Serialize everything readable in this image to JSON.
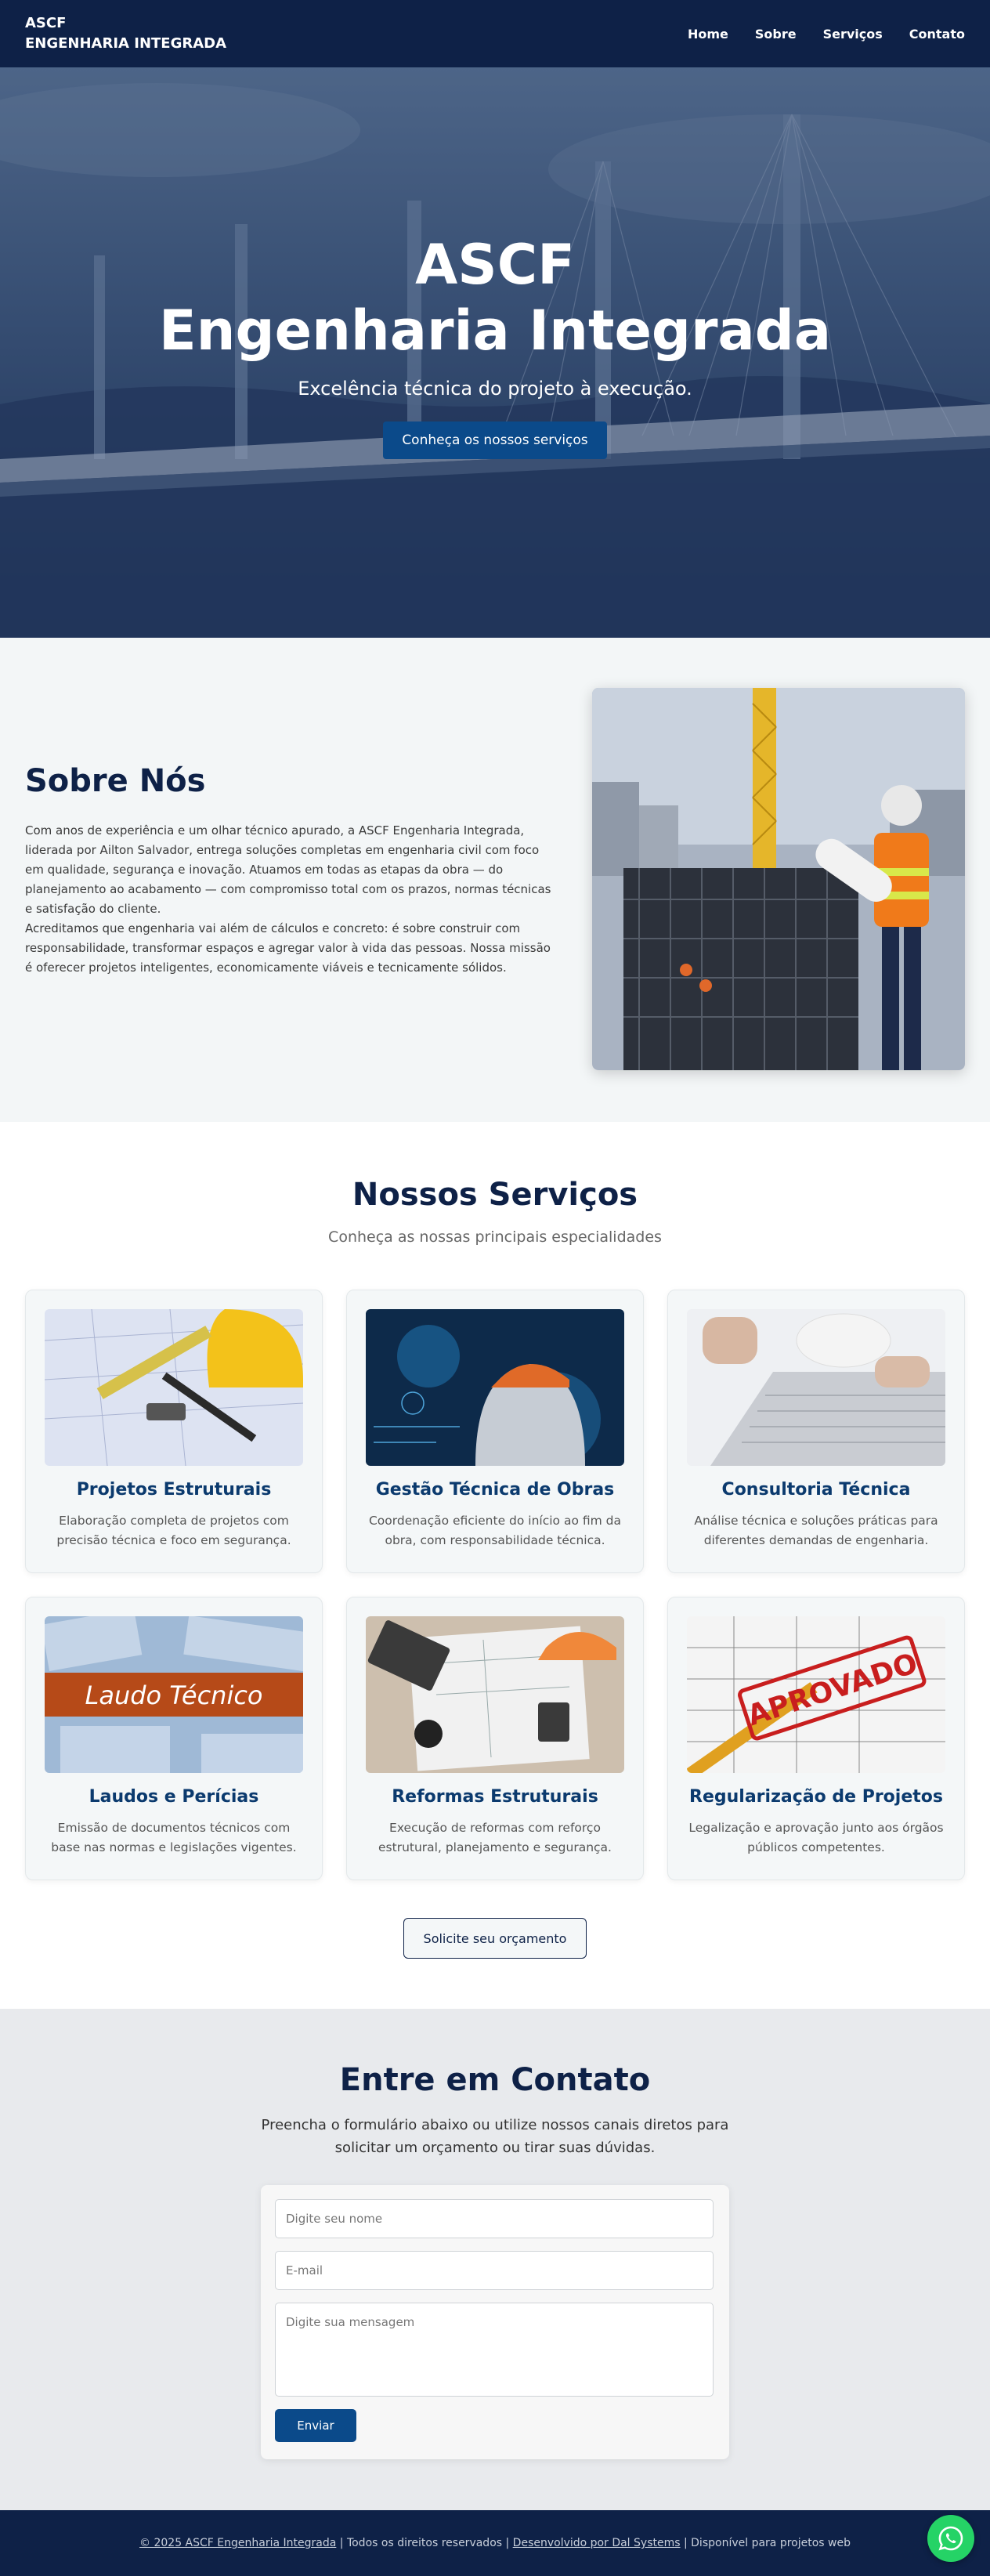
{
  "header": {
    "logo_line1": "ASCF",
    "logo_line2": "ENGENHARIA INTEGRADA",
    "nav": [
      "Home",
      "Sobre",
      "Serviços",
      "Contato"
    ]
  },
  "hero": {
    "title_line1": "ASCF",
    "title_line2": "Engenharia Integrada",
    "subtitle": "Excelência técnica do projeto à execução.",
    "button": "Conheça os nossos serviços"
  },
  "about": {
    "title": "Sobre Nós",
    "paragraph1": "Com anos de experiência e um olhar técnico apurado, a ASCF Engenharia Integrada, liderada por Ailton Salvador, entrega soluções completas em engenharia civil com foco em qualidade, segurança e inovação. Atuamos em todas as etapas da obra — do planejamento ao acabamento — com compromisso total com os prazos, normas técnicas e satisfação do cliente.",
    "paragraph2": "Acreditamos que engenharia vai além de cálculos e concreto: é sobre construir com responsabilidade, transformar espaços e agregar valor à vida das pessoas. Nossa missão é oferecer projetos inteligentes, economicamente viáveis e tecnicamente sólidos."
  },
  "services": {
    "title": "Nossos Serviços",
    "subtitle": "Conheça as nossas principais especialidades",
    "cards": [
      {
        "title": "Projetos Estruturais",
        "desc": "Elaboração completa de projetos com precisão técnica e foco em segurança."
      },
      {
        "title": "Gestão Técnica de Obras",
        "desc": "Coordenação eficiente do início ao fim da obra, com responsabilidade técnica."
      },
      {
        "title": "Consultoria Técnica",
        "desc": "Análise técnica e soluções práticas para diferentes demandas de engenharia."
      },
      {
        "title": "Laudos e Perícias",
        "desc": "Emissão de documentos técnicos com base nas normas e legislações vigentes."
      },
      {
        "title": "Reformas Estruturais",
        "desc": "Execução de reformas com reforço estrutural, planejamento e segurança."
      },
      {
        "title": "Regularização de Projetos",
        "desc": "Legalização e aprovação junto aos órgãos públicos competentes."
      }
    ],
    "image_text_laudo": "Laudo Técnico",
    "image_text_aprovado": "APROVADO",
    "quote_button": "Solicite seu orçamento"
  },
  "contact": {
    "title": "Entre em Contato",
    "subtitle": "Preencha o formulário abaixo ou utilize nossos canais diretos para solicitar um orçamento ou tirar suas dúvidas.",
    "name_placeholder": "Digite seu nome",
    "email_placeholder": "E-mail",
    "message_placeholder": "Digite sua mensagem",
    "send_button": "Enviar"
  },
  "footer": {
    "copyright": "© 2025 ASCF Engenharia Integrada",
    "rights": " | Todos os direitos reservados | ",
    "developer": "Desenvolvido por Dal Systems",
    "tail": " | Disponível para projetos web"
  },
  "colors": {
    "navy": "#0e2147",
    "accent_blue": "#0b4a8a",
    "whatsapp": "#25d366"
  },
  "icons": [
    "whatsapp-icon"
  ]
}
